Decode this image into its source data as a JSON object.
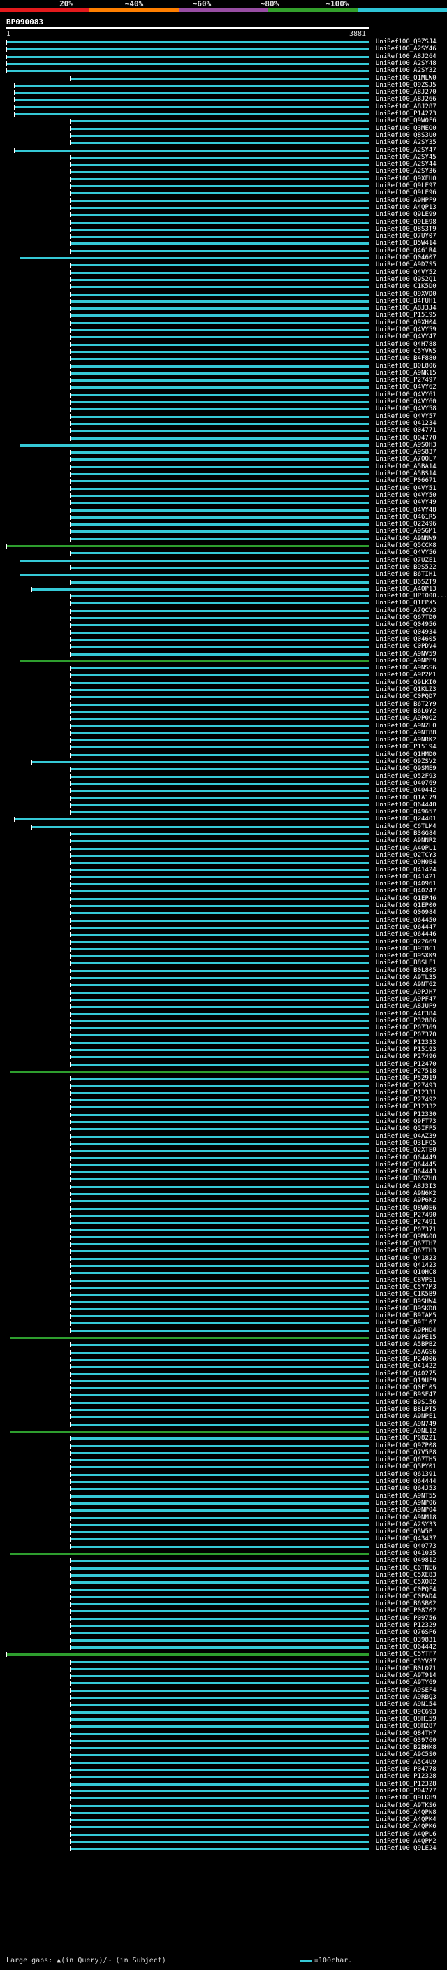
{
  "scale": {
    "labels": [
      "20%",
      "~40%",
      "~60%",
      "~80%",
      "~100%"
    ],
    "colors": [
      "#e41a1c",
      "#ff7f00",
      "#984ea3",
      "#33a02c",
      "#2ec4d6"
    ]
  },
  "query": {
    "title": "BP090083",
    "start": "1",
    "end": "3881"
  },
  "colors": {
    "cyan": "#35c9d6",
    "green": "#2e9e2e",
    "background": "#000000",
    "label": "#ffffff"
  },
  "hits": [
    "UniRef100_Q9ZSJ4",
    "UniRef100_A2SY46",
    "UniRef100_A8J264",
    "UniRef100_A2SY48",
    "UniRef100_A2SY32",
    "UniRef100_Q1MLW0",
    "UniRef100_Q9ZSJ5",
    "UniRef100_A8J270",
    "UniRef100_A8J266",
    "UniRef100_A8J287",
    "UniRef100_P14273",
    "UniRef100_Q9W0F6",
    "UniRef100_Q3MEO0",
    "UniRef100_Q8S3U0",
    "UniRef100_A2SY35",
    "UniRef100_A2SY47",
    "UniRef100_A2SY45",
    "UniRef100_A2SY44",
    "UniRef100_A2SY36",
    "UniRef100_Q9XFU0",
    "UniRef100_Q9LE97",
    "UniRef100_Q9LE96",
    "UniRef100_A9HPF9",
    "UniRef100_A4QP13",
    "UniRef100_Q9LE99",
    "UniRef100_Q9LE98",
    "UniRef100_Q8S3T9",
    "UniRef100_Q7UY07",
    "UniRef100_B5W414",
    "UniRef100_Q461R4",
    "UniRef100_Q04607",
    "UniRef100_A9D7S5",
    "UniRef100_Q4VY52",
    "UniRef100_Q9S2Q1",
    "UniRef100_C1K5D0",
    "UniRef100_Q9XVD0",
    "UniRef100_B4FUH1",
    "UniRef100_A8J3J4",
    "UniRef100_P15195",
    "UniRef100_Q9XH04",
    "UniRef100_Q4VY59",
    "UniRef100_Q4VY47",
    "UniRef100_Q4H788",
    "UniRef100_C5YVW5",
    "UniRef100_B4F880",
    "UniRef100_B0L806",
    "UniRef100_A9NK15",
    "UniRef100_P27497",
    "UniRef100_Q4VY62",
    "UniRef100_Q4VY61",
    "UniRef100_Q4VY60",
    "UniRef100_Q4VY58",
    "UniRef100_Q4VY57",
    "UniRef100_Q41234",
    "UniRef100_Q04771",
    "UniRef100_Q04770",
    "UniRef100_A9S0H3",
    "UniRef100_A9S837",
    "UniRef100_A7QQL7",
    "UniRef100_A5BA14",
    "UniRef100_A5BS14",
    "UniRef100_P06671",
    "UniRef100_Q4VY51",
    "UniRef100_Q4VY50",
    "UniRef100_Q4VY49",
    "UniRef100_Q4VY48",
    "UniRef100_Q461R5",
    "UniRef100_Q22496",
    "UniRef100_A9SGM1",
    "UniRef100_A9NNW9",
    "UniRef100_Q5CCK8",
    "UniRef100_Q4VY56",
    "UniRef100_Q7UZE1",
    "UniRef100_B9S522",
    "UniRef100_B6TIH1",
    "UniRef100_B6SZT9",
    "UniRef100_A4QP13",
    "UniRef100_UPI000...",
    "UniRef100_Q1EPX5",
    "UniRef100_A7QCV3",
    "UniRef100_Q67TD0",
    "UniRef100_Q04956",
    "UniRef100_Q04934",
    "UniRef100_Q04605",
    "UniRef100_C0PDV4",
    "UniRef100_A9NV59",
    "UniRef100_A9NPE9",
    "UniRef100_A9NSS6",
    "UniRef100_A9P2M1",
    "UniRef100_Q9LKI0",
    "UniRef100_Q1KLZ3",
    "UniRef100_C0PQD7",
    "UniRef100_B6T2Y9",
    "UniRef100_B6L0Y2",
    "UniRef100_A9P0Q2",
    "UniRef100_A9NZL0",
    "UniRef100_A9NT88",
    "UniRef100_A9NRK2",
    "UniRef100_P15194",
    "UniRef100_Q1HMD0",
    "UniRef100_Q9ZSV2",
    "UniRef100_Q9SME9",
    "UniRef100_Q52F93",
    "UniRef100_Q40769",
    "UniRef100_Q40442",
    "UniRef100_Q1A179",
    "UniRef100_Q64440",
    "UniRef100_Q49657",
    "UniRef100_Q24401",
    "UniRef100_C6TLM4",
    "UniRef100_B3GG84",
    "UniRef100_A9NNR2",
    "UniRef100_A4QPL1",
    "UniRef100_Q2TCY3",
    "UniRef100_Q9H0B4",
    "UniRef100_Q41424",
    "UniRef100_Q41421",
    "UniRef100_Q40961",
    "UniRef100_Q40247",
    "UniRef100_Q1EP46",
    "UniRef100_Q1EP00",
    "UniRef100_Q00984",
    "UniRef100_Q64450",
    "UniRef100_Q64447",
    "UniRef100_Q64446",
    "UniRef100_Q22669",
    "UniRef100_B9T8C1",
    "UniRef100_B9SXK9",
    "UniRef100_B8SLF1",
    "UniRef100_B0L805",
    "UniRef100_A9TL35",
    "UniRef100_A9NT62",
    "UniRef100_A9PJH7",
    "UniRef100_A9PF47",
    "UniRef100_A8JUP9",
    "UniRef100_A4F384",
    "UniRef100_P32886",
    "UniRef100_P07369",
    "UniRef100_P07370",
    "UniRef100_P12333",
    "UniRef100_P15193",
    "UniRef100_P27496",
    "UniRef100_P12470",
    "UniRef100_P27518",
    "UniRef100_P52919",
    "UniRef100_P27493",
    "UniRef100_P12331",
    "UniRef100_P27492",
    "UniRef100_P12332",
    "UniRef100_P12330",
    "UniRef100_Q9FT73",
    "UniRef100_Q5IFP5",
    "UniRef100_Q4AZ39",
    "UniRef100_Q3LFQ5",
    "UniRef100_Q2XTE0",
    "UniRef100_Q64449",
    "UniRef100_Q64445",
    "UniRef100_Q64443",
    "UniRef100_B6SZH8",
    "UniRef100_A8J3I3",
    "UniRef100_A9N6K2",
    "UniRef100_A9P6K2",
    "UniRef100_Q8W0E6",
    "UniRef100_P27490",
    "UniRef100_P27491",
    "UniRef100_P07371",
    "UniRef100_Q9M600",
    "UniRef100_Q67TH7",
    "UniRef100_Q67TH3",
    "UniRef100_Q41823",
    "UniRef100_Q41423",
    "UniRef100_Q10HC8",
    "UniRef100_C8VPS1",
    "UniRef100_C5Y7M3",
    "UniRef100_C1K5B9",
    "UniRef100_B9SHW4",
    "UniRef100_B9SKD8",
    "UniRef100_B9IAM5",
    "UniRef100_B9I107",
    "UniRef100_A9PHD4",
    "UniRef100_A9PE15",
    "UniRef100_A5BPB2",
    "UniRef100_A5AGS6",
    "UniRef100_P24006",
    "UniRef100_Q41422",
    "UniRef100_Q40275",
    "UniRef100_Q19UF9",
    "UniRef100_Q0F105",
    "UniRef100_B9SF47",
    "UniRef100_B9S156",
    "UniRef100_B8LPT5",
    "UniRef100_A9NPE1",
    "UniRef100_A9N749",
    "UniRef100_A9NL12",
    "UniRef100_P08221",
    "UniRef100_Q9ZP08",
    "UniRef100_Q7V5P8",
    "UniRef100_Q67TH5",
    "UniRef100_Q5PY01",
    "UniRef100_Q61391",
    "UniRef100_Q64444",
    "UniRef100_Q64J53",
    "UniRef100_A9NT55",
    "UniRef100_A9NP06",
    "UniRef100_A9NP04",
    "UniRef100_A9NM18",
    "UniRef100_A2SY33",
    "UniRef100_Q5W5B",
    "UniRef100_Q43437",
    "UniRef100_Q40773",
    "UniRef100_Q41035",
    "UniRef100_Q49812",
    "UniRef100_C6TNE6",
    "UniRef100_C5XE83",
    "UniRef100_C5XQ82",
    "UniRef100_C0PQF4",
    "UniRef100_C0PAD4",
    "UniRef100_B6SB02",
    "UniRef100_P08702",
    "UniRef100_P09756",
    "UniRef100_P12329",
    "UniRef100_Q76SP6",
    "UniRef100_Q39831",
    "UniRef100_Q64442",
    "UniRef100_C5YTF7",
    "UniRef100_C5YV87",
    "UniRef100_B0L071",
    "UniRef100_A9T914",
    "UniRef100_A9TY69",
    "UniRef100_A9SEF4",
    "UniRef100_A9RBQ3",
    "UniRef100_A9N154",
    "UniRef100_Q9C693",
    "UniRef100_Q8H159",
    "UniRef100_Q8H287",
    "UniRef100_Q84TH7",
    "UniRef100_Q39760",
    "UniRef100_B2BHK8",
    "UniRef100_A9C5S0",
    "UniRef100_A5C4U9",
    "UniRef100_P04778",
    "UniRef100_P12328",
    "UniRef100_P12328",
    "UniRef100_P04777",
    "UniRef100_Q9LKH9",
    "UniRef100_A9TKS6",
    "UniRef100_A4QPN8",
    "UniRef100_A4QPK4",
    "UniRef100_A4QPK6",
    "UniRef100_A4QPL6",
    "UniRef100_A4QPM2",
    "UniRef100_Q9LE24"
  ],
  "footer": {
    "legend_text": "Large gaps: ▲(in Query)/~ (in Subject)",
    "scale_text": "=100char."
  }
}
